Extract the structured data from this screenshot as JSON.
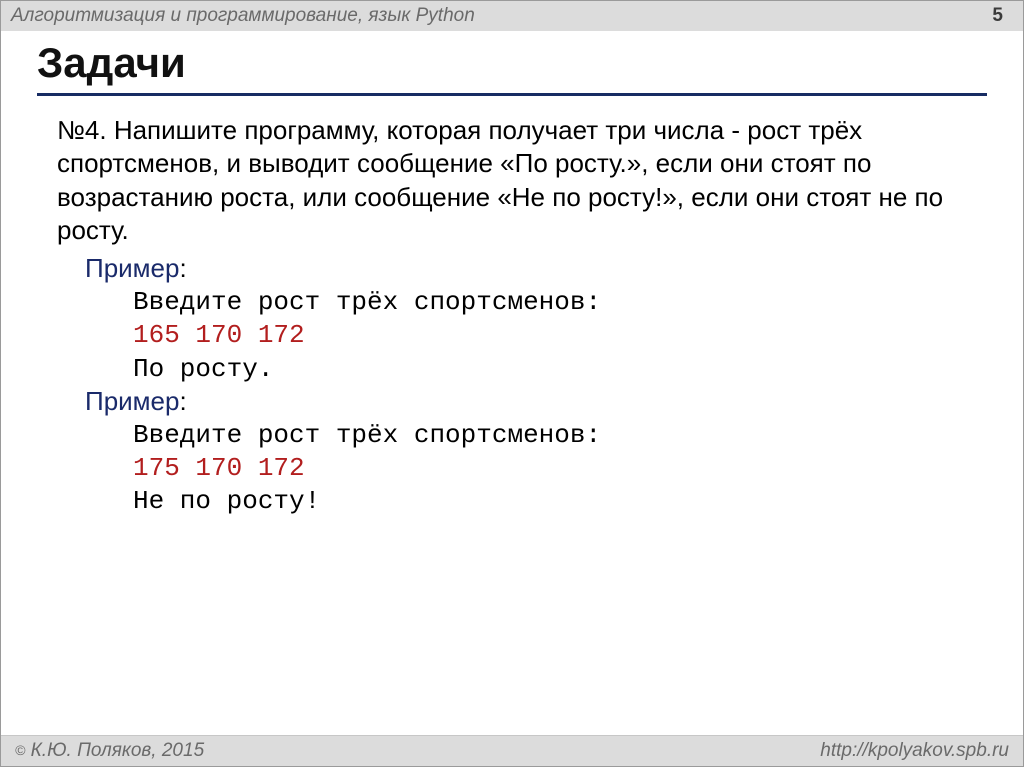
{
  "header": {
    "title": "Алгоритмизация и программирование, язык Python",
    "page_number": "5"
  },
  "heading": "Задачи",
  "task": {
    "prefix": "№4.",
    "text": "Напишите программу, которая получает три числа  - рост трёх спортсменов, и выводит сообщение «По росту.», если они стоят по возрастанию роста, или сообщение «Не по росту!», если они стоят не по росту."
  },
  "examples": [
    {
      "label": "Пример",
      "colon": ":",
      "prompt": "Введите рост трёх спортсменов:",
      "input": "165 170 172",
      "output": "По росту."
    },
    {
      "label": "Пример",
      "colon": ":",
      "prompt": "Введите рост трёх спортсменов:",
      "input": "175 170 172",
      "output": "Не по росту!"
    }
  ],
  "footer": {
    "copyright": "К.Ю. Поляков, 2015",
    "url": "http://kpolyakov.spb.ru"
  }
}
